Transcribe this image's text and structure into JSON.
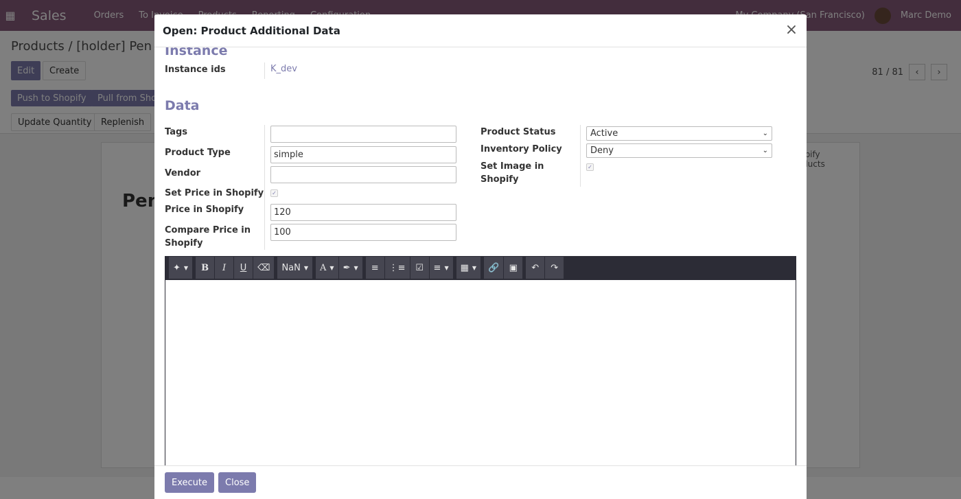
{
  "app": {
    "name": "Sales",
    "menu": [
      "Orders",
      "To Invoice",
      "Products",
      "Reporting",
      "Configuration"
    ],
    "company": "My Company (San Francisco)",
    "user": "Marc Demo"
  },
  "background": {
    "breadcrumb": "Products / [holder] Pen h",
    "edit_label": "Edit",
    "create_label": "Create",
    "push_label": "Push to Shopify",
    "pull_label": "Pull from Sho",
    "update_qty_label": "Update Quantity",
    "replenish_label": "Replenish",
    "pager_text": "81 / 81",
    "sheet_title": "Pen",
    "shopify_products": "Shopify Products"
  },
  "modal": {
    "title": "Open: Product Additional Data",
    "close_glyph": "×",
    "instance": {
      "section_title": "Instance",
      "label": "Instance ids",
      "value": "K_dev"
    },
    "data": {
      "section_title": "Data",
      "tags_label": "Tags",
      "tags_value": "",
      "product_type_label": "Product Type",
      "product_type_value": "simple",
      "vendor_label": "Vendor",
      "vendor_value": "",
      "set_price_label": "Set Price in Shopify",
      "set_price_checked": true,
      "price_label": "Price in Shopify",
      "price_value": "120",
      "compare_price_label": "Compare Price in Shopify",
      "compare_price_value": "100",
      "product_status_label": "Product Status",
      "product_status_value": "Active",
      "inventory_policy_label": "Inventory Policy",
      "inventory_policy_value": "Deny",
      "set_image_label": "Set Image in Shopify",
      "set_image_checked": true
    },
    "editor": {
      "font_size": "NaN"
    },
    "footer": {
      "execute_label": "Execute",
      "close_label": "Close"
    }
  }
}
